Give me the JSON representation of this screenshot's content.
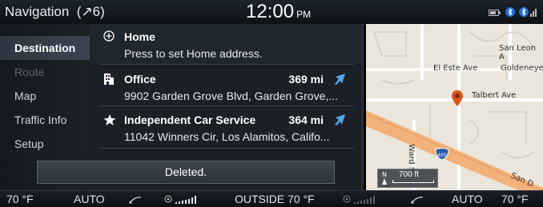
{
  "status_bar": {
    "title": "Navigation",
    "indicator": "(↗6)",
    "time": "12:00",
    "ampm": "PM"
  },
  "sidebar": {
    "items": [
      {
        "label": "Destination",
        "state": "active"
      },
      {
        "label": "Route",
        "state": "disabled"
      },
      {
        "label": "Map",
        "state": "normal"
      },
      {
        "label": "Traffic Info",
        "state": "normal"
      },
      {
        "label": "Setup",
        "state": "normal"
      }
    ]
  },
  "destinations": [
    {
      "icon": "add-circle-icon",
      "title": "Home",
      "subtitle": "Press to set Home address.",
      "distance": ""
    },
    {
      "icon": "building-icon",
      "title": "Office",
      "subtitle": "9902 Garden Grove Blvd, Garden Grove,...",
      "distance": "369 mi",
      "direction_icon": "direction-arrow-icon"
    },
    {
      "icon": "star-icon",
      "title": "Independent Car Service",
      "subtitle": "11042 Winners Cir, Los Alamitos, Califo...",
      "distance": "364 mi",
      "direction_icon": "direction-arrow-icon"
    }
  ],
  "toast": {
    "message": "Deleted."
  },
  "map": {
    "streets": [
      "San Leon A",
      "El Este Ave",
      "Goldeneye",
      "Talbert Ave",
      "Ward S",
      "San D"
    ],
    "highway_shield": "405",
    "scale_label": "700 ft",
    "north_label": "N",
    "colors": {
      "land": "#ebe6db",
      "highway": "#f2b27a",
      "pin": "#d9571f"
    }
  },
  "climate": {
    "left_temp": "70 °F",
    "left_mode": "AUTO",
    "outside": "OUTSIDE 70 °F",
    "right_mode": "AUTO",
    "right_temp": "70 °F"
  }
}
